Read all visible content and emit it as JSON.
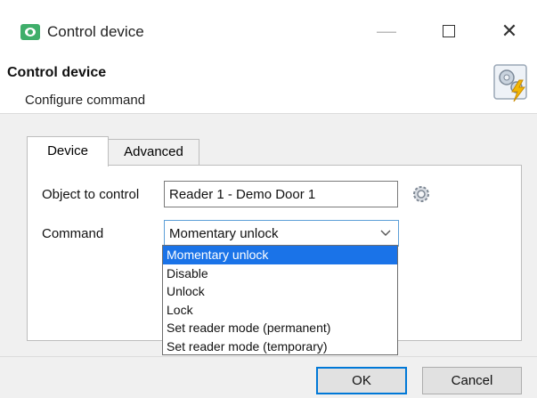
{
  "window": {
    "title": "Control device",
    "controls": {
      "minimize": "—",
      "maximize": "",
      "close": "✕"
    }
  },
  "header": {
    "title": "Control device",
    "subtitle": "Configure command",
    "icon": "gear-lightning-icon"
  },
  "tabs": [
    {
      "label": "Device",
      "active": true
    },
    {
      "label": "Advanced",
      "active": false
    }
  ],
  "form": {
    "object_label": "Object to control",
    "object_value": "Reader 1 - Demo Door 1",
    "command_label": "Command",
    "command_value": "Momentary unlock"
  },
  "dropdown": {
    "highlighted_index": 0,
    "options": [
      "Momentary unlock",
      "Disable",
      "Unlock",
      "Lock",
      "Set reader mode (permanent)",
      "Set reader mode (temporary)"
    ]
  },
  "buttons": {
    "ok": "OK",
    "cancel": "Cancel"
  },
  "colors": {
    "accent": "#0078d7",
    "selection": "#1a73e8",
    "app_icon": "#3fae6a"
  }
}
